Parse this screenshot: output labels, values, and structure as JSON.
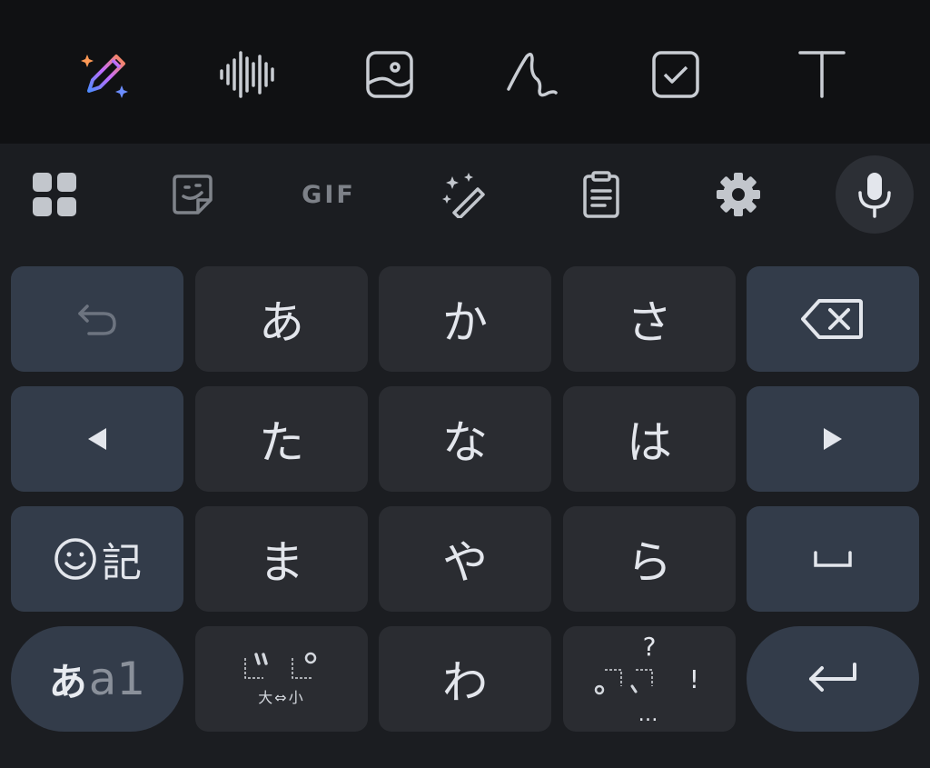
{
  "toolbar": {
    "tools": [
      {
        "icon": "ai-pen-sparkle-icon"
      },
      {
        "icon": "voice-waveform-icon"
      },
      {
        "icon": "image-icon"
      },
      {
        "icon": "handwriting-icon"
      },
      {
        "icon": "checkbox-icon"
      },
      {
        "icon": "text-format-icon"
      }
    ]
  },
  "suggestion_bar": {
    "gif_label": "GIF",
    "icons": [
      "apps-grid-icon",
      "sticker-icon",
      "gif-icon",
      "magic-wand-icon",
      "clipboard-icon",
      "gear-icon",
      "microphone-icon"
    ]
  },
  "keyboard": {
    "kana": {
      "a": "あ",
      "ka": "か",
      "sa": "さ",
      "ta": "た",
      "na": "な",
      "ha": "は",
      "ma": "ま",
      "ya": "や",
      "ra": "ら",
      "wa": "わ"
    },
    "emoji_key_label": "記",
    "mode_key": {
      "primary": "あ",
      "secondary": "a1"
    },
    "dakuten_key": {
      "sub": "大⇔小"
    },
    "punct_key": {
      "top": "?",
      "right": "!",
      "bottom": "…"
    }
  },
  "colors": {
    "toolbar_bg": "#101113",
    "keyboard_bg": "#1b1d21",
    "key_bg": "#2a2c31",
    "function_key_bg": "#333c4a",
    "text": "#e3e6ec"
  }
}
